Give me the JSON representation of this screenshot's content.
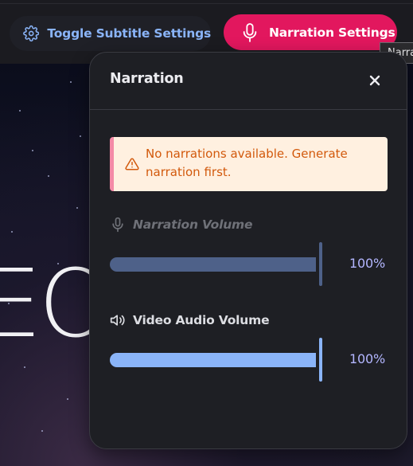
{
  "toolbar": {
    "toggle_subtitle_label": "Toggle Subtitle Settings",
    "narration_settings_label": "Narration Settings",
    "tooltip_text": "Narration Settings"
  },
  "background": {
    "title_fragment": "EO"
  },
  "panel": {
    "title": "Narration",
    "alert": {
      "message": "No narrations available. Generate narration first.",
      "icon": "warning-icon"
    },
    "narration_volume": {
      "label": "Narration Volume",
      "value_text": "100%",
      "level": 1.0,
      "disabled": true,
      "icon": "microphone-icon"
    },
    "video_audio_volume": {
      "label": "Video Audio Volume",
      "value_text": "100%",
      "level": 1.0,
      "disabled": false,
      "icon": "speaker-icon"
    }
  },
  "colors": {
    "accent_pink": "#e2175e",
    "accent_blue": "#8ab4f8",
    "alert_bg": "#fff0e0",
    "alert_text": "#d2590c"
  }
}
